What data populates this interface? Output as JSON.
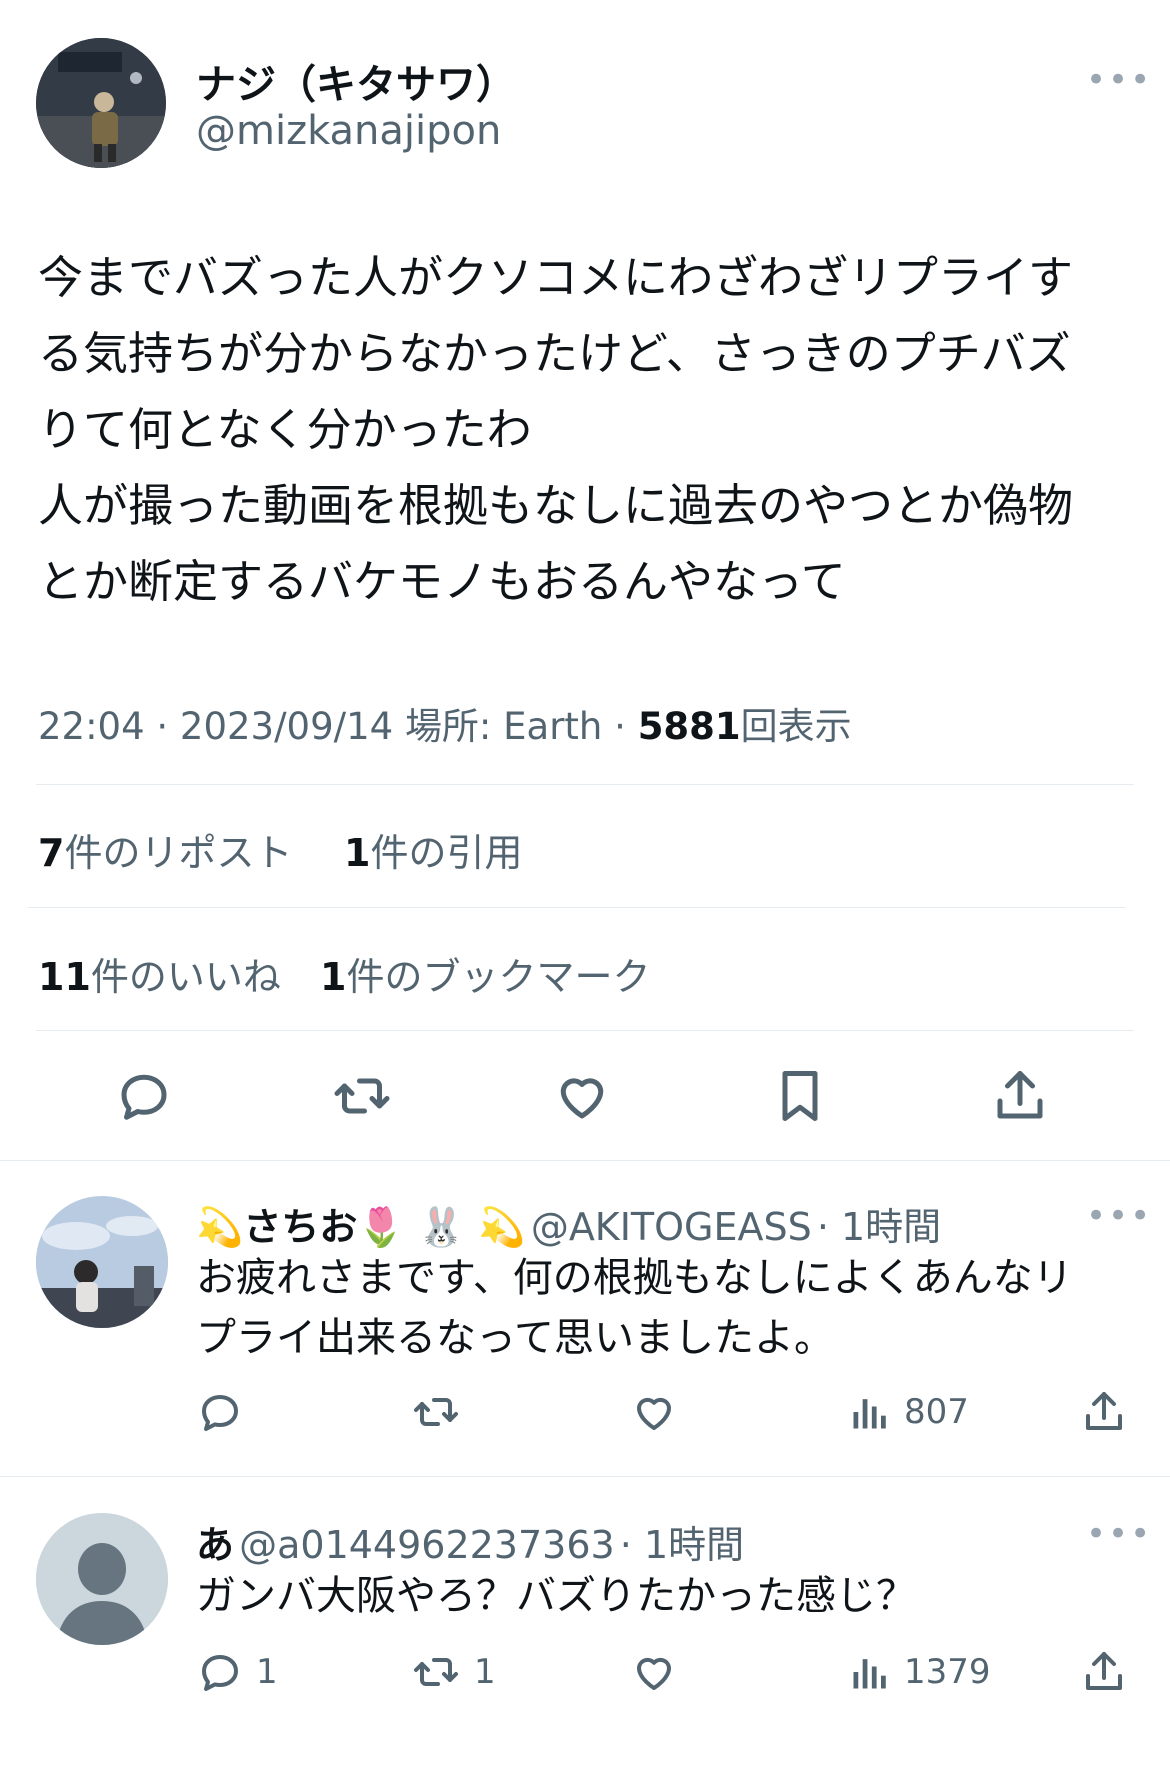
{
  "tweet": {
    "display_name": "ナジ（キタサワ）",
    "handle": "@mizkanajipon",
    "more_label": "•••",
    "body_lines": [
      "今までバズった人がクソコメにわざわざリプライす",
      "る気持ちが分からなかったけど、さっきのプチバズ",
      "りて何となく分かったわ",
      "人が撮った動画を根拠もなしに過去のやつとか偽物",
      "とか断定するバケモノもおるんやなって"
    ],
    "meta": {
      "time": "22:04 · 2023/09/14",
      "location": "場所: Earth ·",
      "views_count": "5881",
      "views_label": "回表示"
    },
    "stats": {
      "reposts_count": "7",
      "reposts_label": "件のリポスト",
      "quotes_count": "1",
      "quotes_label": "件の引用",
      "likes_count": "11",
      "likes_label": "件のいいね",
      "bookmarks_count": "1",
      "bookmarks_label": "件のブックマーク"
    },
    "actions": [
      "reply-icon",
      "repost-icon",
      "like-icon",
      "bookmark-icon",
      "share-icon"
    ]
  },
  "replies": [
    {
      "display_name": "💫さちお🌷 🐰 💫",
      "handle": "@AKITOGEASS",
      "time": "· 1時間",
      "more_label": "•••",
      "text_lines": [
        "お疲れさまです、何の根拠もなしによくあんなリ",
        "プライ出来るなって思いましたよ。"
      ],
      "reply_count": "",
      "repost_count": "",
      "views": "807"
    },
    {
      "display_name": "あ",
      "handle": "@a0144962237363",
      "time": "· 1時間",
      "more_label": "•••",
      "text_lines": [
        "ガンバ大阪やろ？バズりたかった感じ？"
      ],
      "reply_count": "1",
      "repost_count": "1",
      "views": "1379"
    }
  ],
  "colors": {
    "text": "#0f1419",
    "muted": "#536471",
    "divider": "#e6ebef",
    "icon": "#536471"
  }
}
